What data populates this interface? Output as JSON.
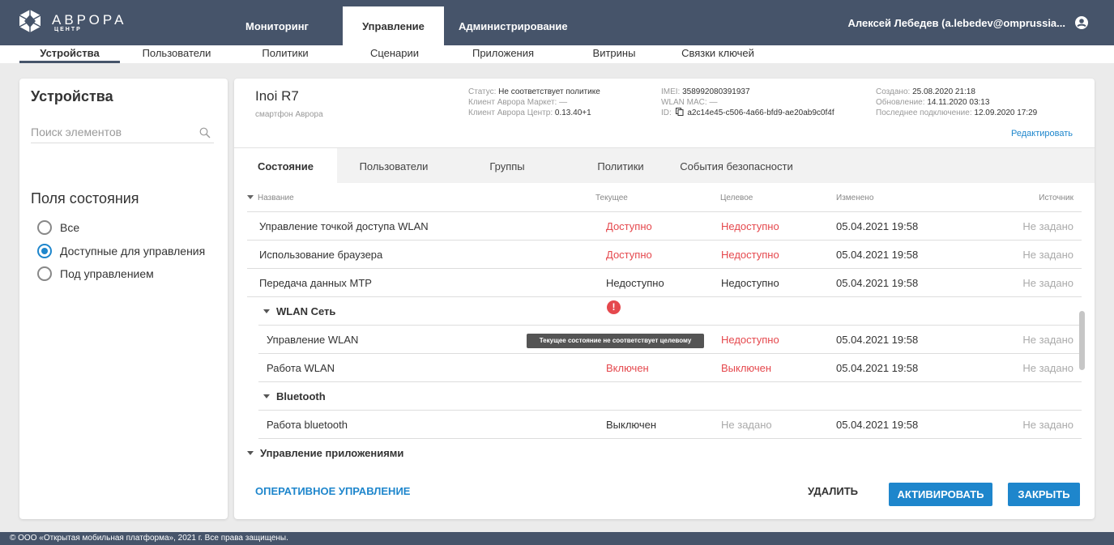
{
  "brand": {
    "title": "АВРОРА",
    "subtitle": "ЦЕНТР"
  },
  "main_tabs": [
    "Мониторинг",
    "Управление",
    "Администрирование"
  ],
  "user": {
    "name": "Алексей Лебедев (a.lebedev@omprussia...",
    "icon": "user-circle-icon"
  },
  "sub_nav": [
    "Устройства",
    "Пользователи",
    "Политики",
    "Сценарии",
    "Приложения",
    "Витрины",
    "Связки ключей"
  ],
  "sidebar": {
    "title": "Устройства",
    "search_placeholder": "Поиск элементов",
    "section_title": "Поля состояния",
    "radio_options": [
      "Все",
      "Доступные для управления",
      "Под управлением"
    ],
    "selected": "Доступные для управления"
  },
  "device": {
    "name": "Inoi R7",
    "type": "смартфон Аврора",
    "status_label": "Статус:",
    "status_value": "Не соответствует политике",
    "market_client": "Клиент Аврора Маркет: —",
    "center_client_label": "Клиент Аврора Центр:",
    "center_client_value": "0.13.40+1",
    "imei_label": "IMEI:",
    "imei_value": "358992080391937",
    "wlan_mac": "WLAN MAC: —",
    "id_label": "ID:",
    "id_value": "a2c14e45-c506-4a66-bfd9-ae20ab9c0f4f",
    "created_label": "Создано:",
    "created_value": "25.08.2020 21:18",
    "updated_label": "Обновление:",
    "updated_value": "14.11.2020 03:13",
    "last_conn_label": "Последнее подключение:",
    "last_conn_value": "12.09.2020 17:29",
    "edit_link": "Редактировать"
  },
  "device_tabs": [
    "Состояние",
    "Пользователи",
    "Группы",
    "Политики",
    "События безопасности"
  ],
  "table": {
    "headers": {
      "name": "Название",
      "current": "Текущее",
      "target": "Целевое",
      "changed": "Изменено",
      "source": "Источник"
    },
    "rows": [
      {
        "name": "Управление точкой доступа WLAN",
        "current": "Доступно",
        "target": "Недоступно",
        "changed": "05.04.2021 19:58",
        "source": "Не задано"
      },
      {
        "name": "Использование браузера",
        "current": "Доступно",
        "target": "Недоступно",
        "changed": "05.04.2021 19:58",
        "source": "Не задано"
      },
      {
        "name": "Передача данных MTP",
        "current": "Недоступно",
        "target": "Недоступно",
        "changed": "05.04.2021 19:58",
        "source": "Не задано"
      },
      {
        "group": "WLAN Сеть"
      },
      {
        "name": "Управление WLAN",
        "current": "",
        "target": "Недоступно",
        "changed": "05.04.2021 19:58",
        "source": "Не задано"
      },
      {
        "name": "Работа WLAN",
        "current": "Включен",
        "target": "Выключен",
        "changed": "05.04.2021 19:58",
        "source": "Не задано"
      },
      {
        "group": "Bluetooth"
      },
      {
        "name": "Работа bluetooth",
        "current": "Выключен",
        "target": "Не задано",
        "changed": "05.04.2021 19:58",
        "source": "Не задано"
      },
      {
        "group": "Управление приложениями"
      }
    ],
    "tooltip": "Текущее состояние не соответствует целевому",
    "warning_icon": "exclamation-circle-icon"
  },
  "actions": {
    "operational": "ОПЕРАТИВНОЕ УПРАВЛЕНИЕ",
    "delete": "УДАЛИТЬ",
    "activate": "АКТИВИРОВАТЬ",
    "close": "ЗАКРЫТЬ"
  },
  "footer": "© ООО «Открытая мобильная платформа», 2021 г. Все права защищены.",
  "colors": {
    "header": "#46546a",
    "accent": "#1e86cc",
    "danger": "#e5484d"
  }
}
